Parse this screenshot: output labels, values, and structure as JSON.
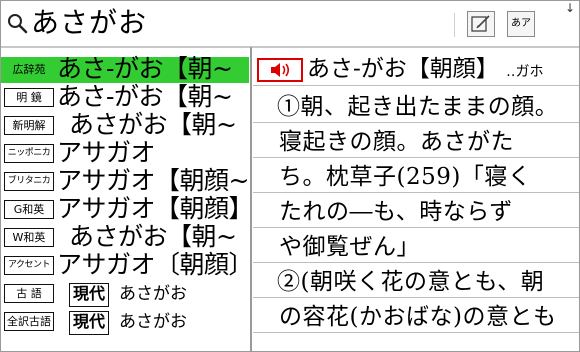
{
  "search": {
    "query": "あさがお",
    "edit_icon": "pen-edit-icon",
    "kana_button_label": "あア",
    "corner_icon": "arrow-down-icon"
  },
  "colors": {
    "selected_row": "#33cc33",
    "speaker": "#dd0000"
  },
  "entries": [
    {
      "tag": "広辞苑",
      "text": "あさ‐がお【朝~",
      "selected": true
    },
    {
      "tag": "明 鏡",
      "text": "あさ‐がお【朝~"
    },
    {
      "tag": "新明解",
      "text": "あさがお【朝~"
    },
    {
      "tag": "ニッポニカ",
      "text": "アサガオ"
    },
    {
      "tag": "ブリタニカ",
      "text": "アサガオ【朝顔~"
    },
    {
      "tag": "G和英",
      "text": "アサガオ【朝顔】"
    },
    {
      "tag": "W和英",
      "text": "あさがお【朝~"
    },
    {
      "tag": "アクセント",
      "text": "アサガオ〔朝顔〕"
    },
    {
      "tag": "古 語",
      "badge": "現代",
      "reading": "あさがお"
    },
    {
      "tag": "全訳古語",
      "badge": "現代",
      "reading": "あさがお"
    }
  ],
  "article": {
    "headword": "あさ‐がお【朝顔】",
    "headword_suffix": "‥ガホ",
    "lines": [
      "①朝、起き出たままの顔。",
      "寝起きの顔。あさがた",
      "ち。枕草子(259)「寝く",
      "たれの―も、時ならず",
      "や御覧ぜん」",
      "②(朝咲く花の意とも、朝",
      "の容花(かおばな)の意とも"
    ]
  }
}
